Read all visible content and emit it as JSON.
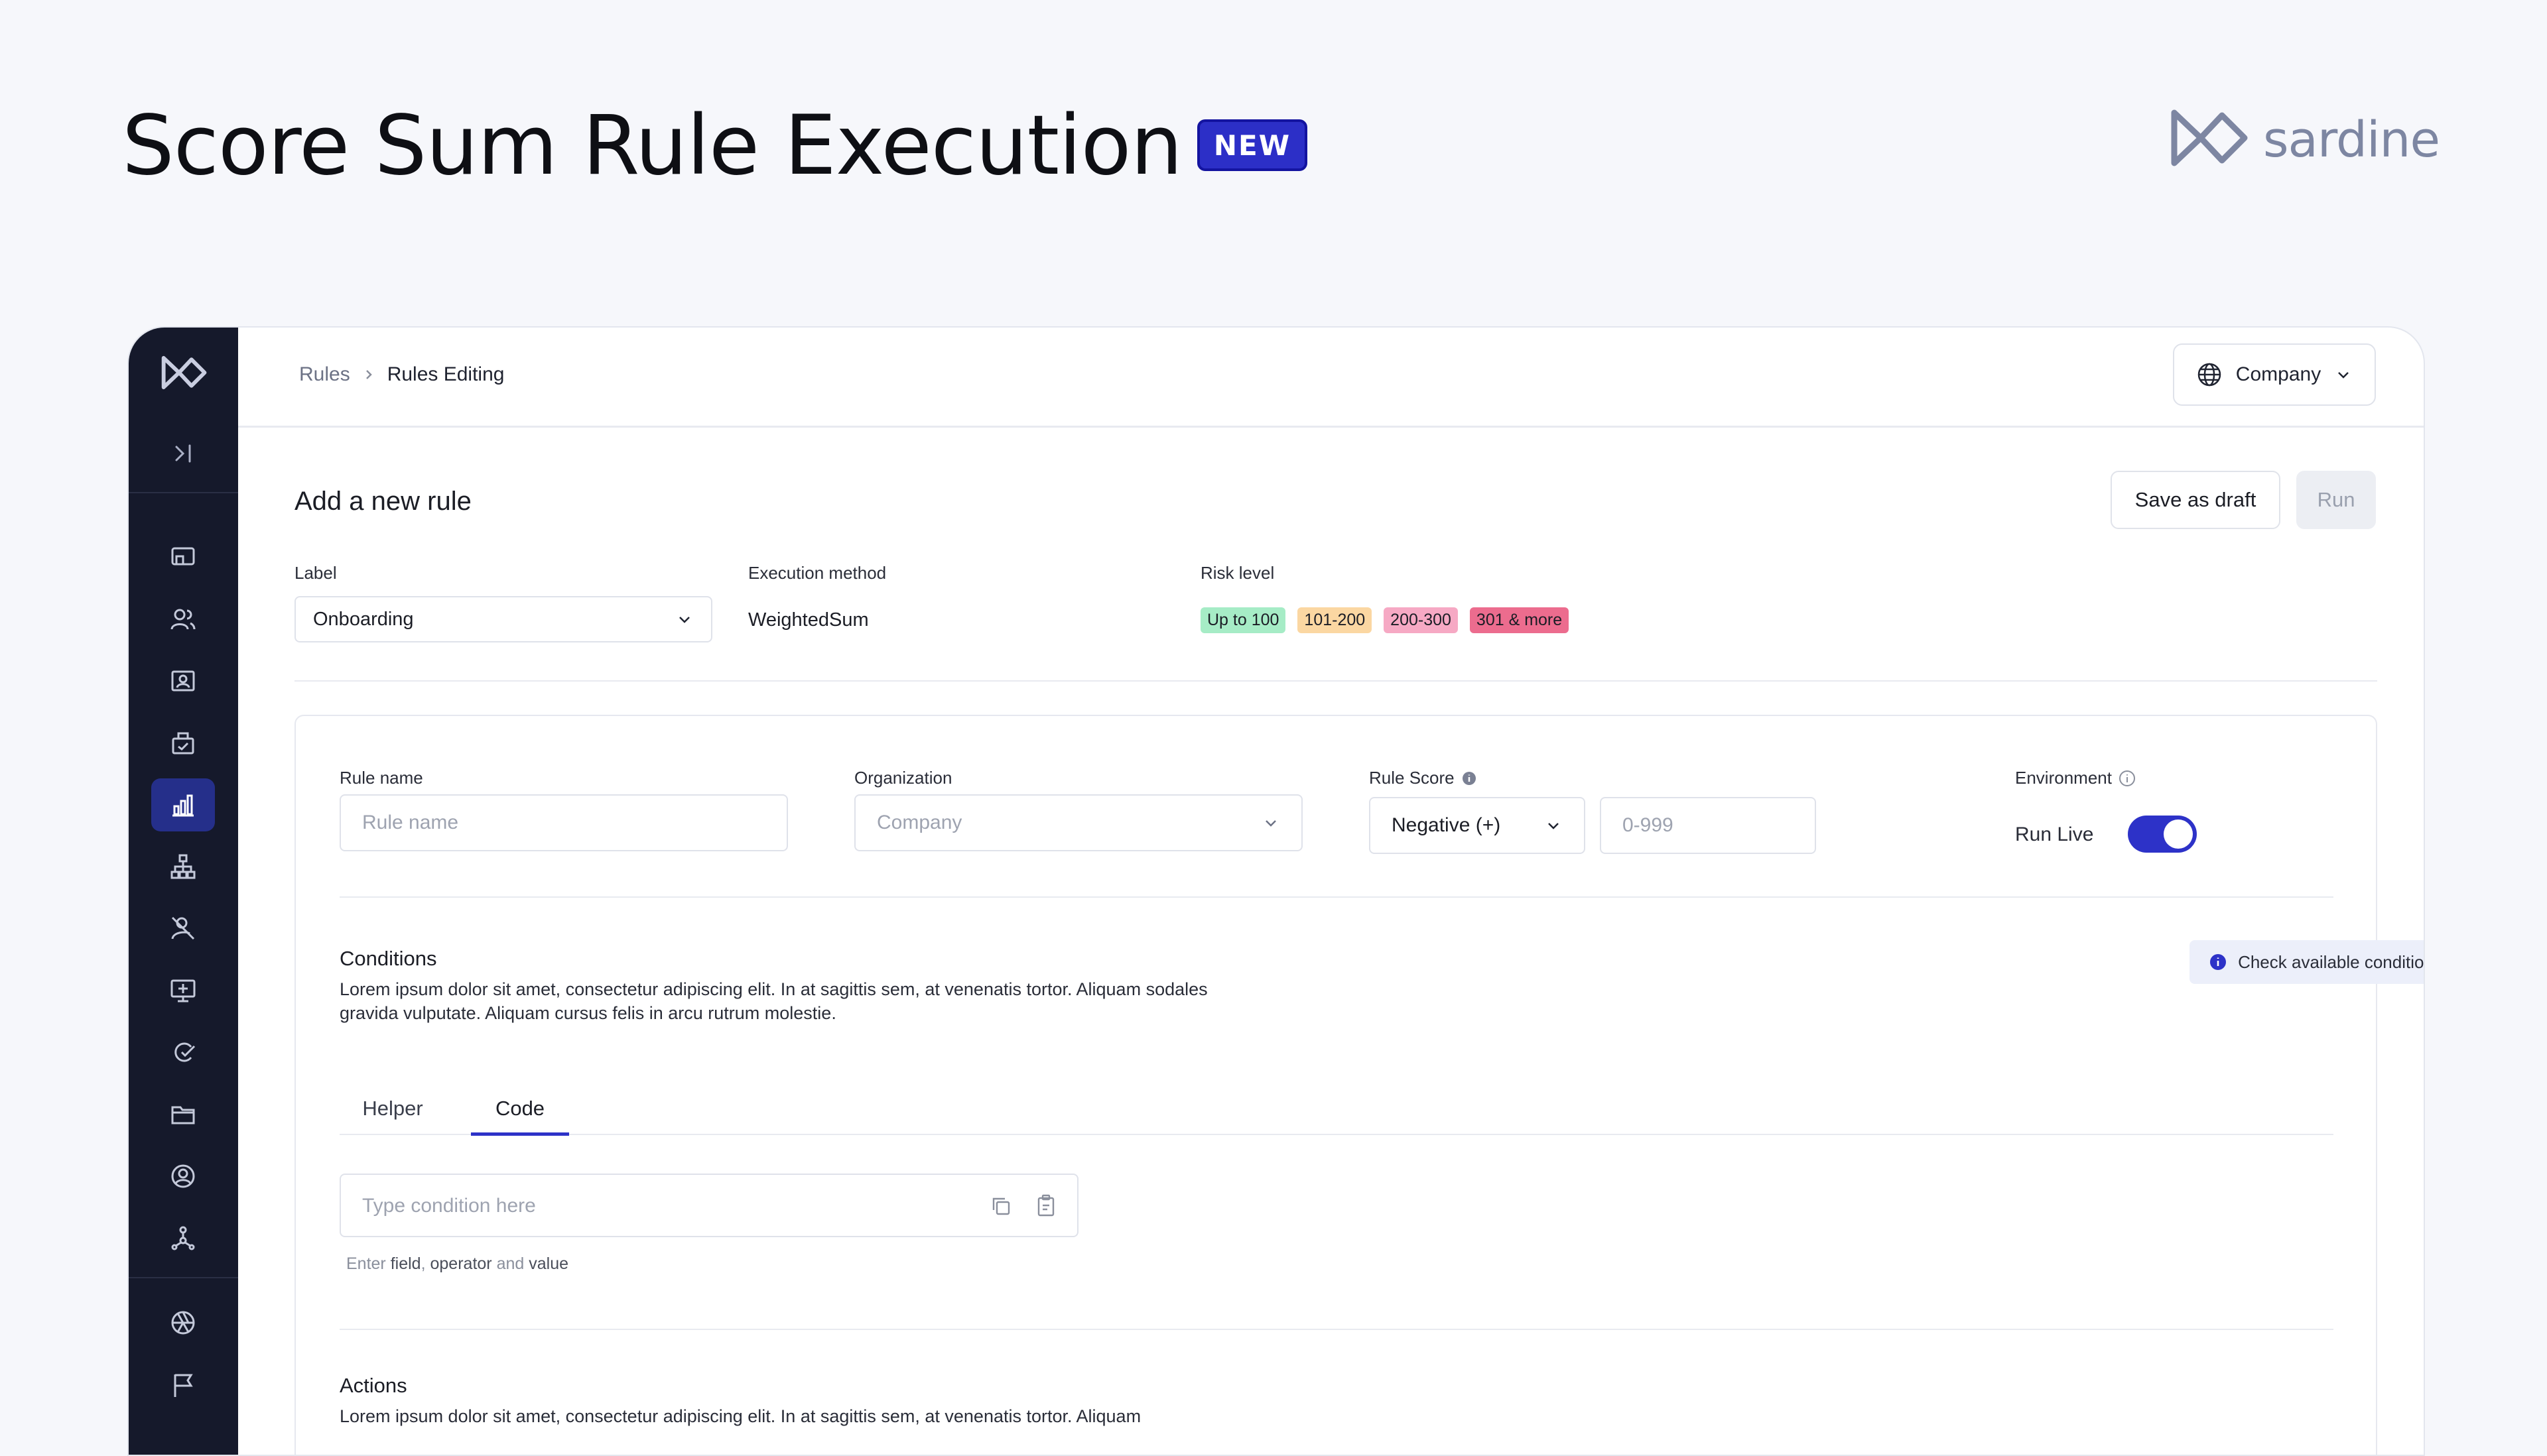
{
  "headline": "Score Sum Rule Execution",
  "badge": "NEW",
  "brand": {
    "name": "sardine",
    "color": "#7d86a2"
  },
  "breadcrumb": {
    "root": "Rules",
    "current": "Rules Editing"
  },
  "company_switcher": {
    "label": "Company",
    "icon": "globe-icon"
  },
  "page": {
    "title": "Add a new rule",
    "save_draft": "Save as draft",
    "run": "Run"
  },
  "rule_meta": {
    "label_title": "Label",
    "label_value": "Onboarding",
    "execution_title": "Execution method",
    "execution_value": "WeightedSum",
    "risk_title": "Risk level",
    "risk_levels": [
      {
        "label": "Up to 100",
        "color": "#a6ecc6"
      },
      {
        "label": "101-200",
        "color": "#fbd7a2"
      },
      {
        "label": "200-300",
        "color": "#f6a9c4"
      },
      {
        "label": "301 & more",
        "color": "#ec6c8e"
      }
    ]
  },
  "form": {
    "rule_name_label": "Rule name",
    "rule_name_placeholder": "Rule name",
    "organization_label": "Organization",
    "organization_value": "Company",
    "rule_score_label": "Rule Score",
    "rule_score_sign": "Negative (+)",
    "rule_score_placeholder": "0-999",
    "environment_label": "Environment",
    "run_live_label": "Run Live",
    "run_live_on": true
  },
  "conditions": {
    "title": "Conditions",
    "description": "Lorem ipsum dolor sit amet, consectetur adipiscing elit. In at sagittis sem, at venenatis tortor. Aliquam sodales gravida vulputate. Aliquam cursus felis in arcu rutrum molestie.",
    "check_button": "Check available conditions",
    "tabs": [
      "Helper",
      "Code"
    ],
    "active_tab": "Code",
    "input_placeholder": "Type condition here",
    "helper_prefix": "Enter",
    "helper_field": "field",
    "helper_sep": ",",
    "helper_operator": "operator",
    "helper_and": "and",
    "helper_value": "value"
  },
  "actions": {
    "title": "Actions",
    "description": "Lorem ipsum dolor sit amet, consectetur adipiscing elit. In at sagittis sem, at venenatis tortor. Aliquam"
  },
  "sidebar": {
    "icons": [
      "dashboard-icon",
      "users-icon",
      "id-card-icon",
      "briefcase-icon",
      "bar-chart-icon",
      "hierarchy-icon",
      "user-off-icon",
      "monitor-plus-icon",
      "check-chat-icon",
      "folder-icon",
      "user-circle-icon",
      "network-icon",
      "aperture-icon",
      "flag-icon"
    ],
    "active": "bar-chart-icon"
  },
  "colors": {
    "accent": "#2d32c8",
    "sidebar": "#15192b",
    "sidebar_active": "#252f8a"
  }
}
